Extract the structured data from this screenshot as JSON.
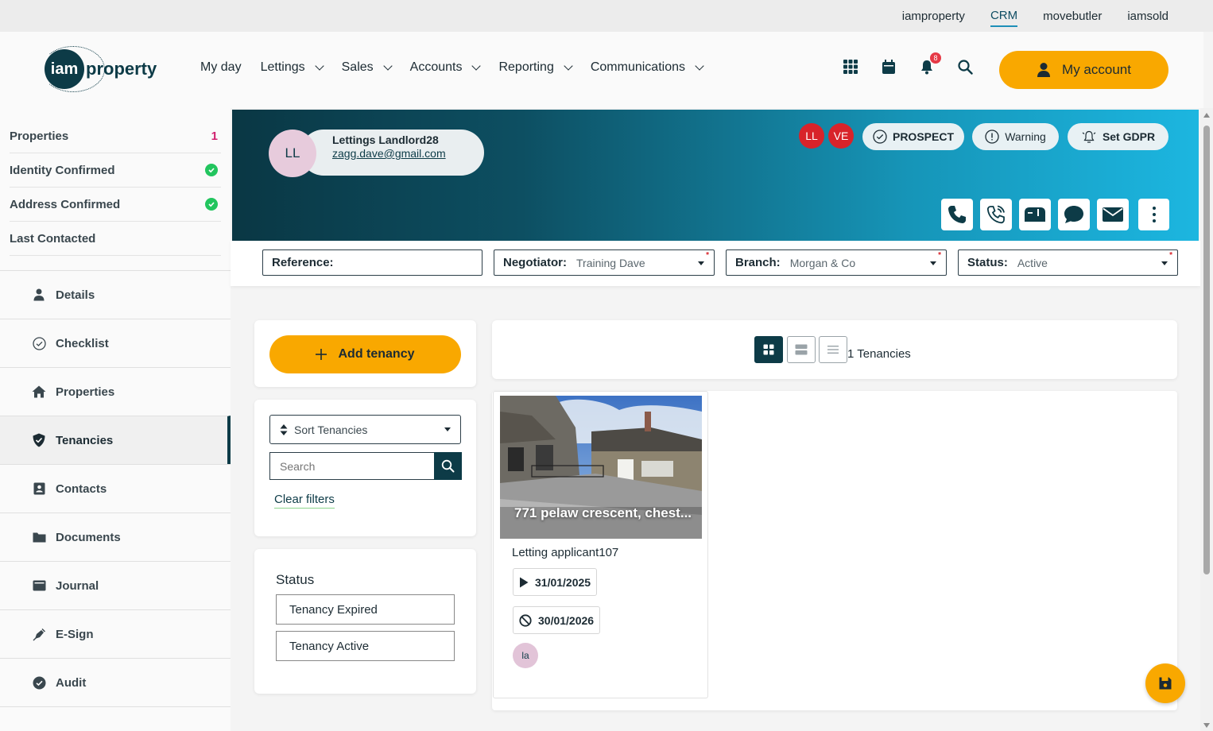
{
  "topbar": {
    "links": [
      "iamproperty",
      "CRM",
      "movebutler",
      "iamsold"
    ],
    "active": "CRM"
  },
  "header": {
    "logo_mark": "iam",
    "logo_word": "property",
    "nav": [
      {
        "label": "My day",
        "has_dropdown": false
      },
      {
        "label": "Lettings",
        "has_dropdown": true
      },
      {
        "label": "Sales",
        "has_dropdown": true
      },
      {
        "label": "Accounts",
        "has_dropdown": true
      },
      {
        "label": "Reporting",
        "has_dropdown": true
      },
      {
        "label": "Communications",
        "has_dropdown": true
      }
    ],
    "icons": [
      "apps-grid-icon",
      "calendar-icon",
      "bell-icon",
      "search-icon"
    ],
    "notification_count": "8",
    "account_label": "My account"
  },
  "sidebar": {
    "summary": [
      {
        "label": "Properties",
        "value": "1"
      },
      {
        "label": "Identity Confirmed",
        "status": "confirmed"
      },
      {
        "label": "Address Confirmed",
        "status": "confirmed"
      },
      {
        "label": "Last Contacted",
        "value": ""
      }
    ],
    "menu": [
      {
        "label": "Details",
        "icon": "person-icon"
      },
      {
        "label": "Checklist",
        "icon": "check-circle-icon"
      },
      {
        "label": "Properties",
        "icon": "home-icon"
      },
      {
        "label": "Tenancies",
        "icon": "shield-icon",
        "active": true
      },
      {
        "label": "Contacts",
        "icon": "contact-card-icon"
      },
      {
        "label": "Documents",
        "icon": "folder-icon"
      },
      {
        "label": "Journal",
        "icon": "journal-icon"
      },
      {
        "label": "E-Sign",
        "icon": "pen-icon"
      },
      {
        "label": "Audit",
        "icon": "check-badge-icon"
      }
    ]
  },
  "contact": {
    "initials": "LL",
    "name": "Lettings Landlord28",
    "email": "zagg.dave@gmail.com",
    "tag_avatars": [
      "LL",
      "VE"
    ],
    "pills": {
      "prospect": "PROSPECT",
      "warning": "Warning",
      "gdpr": "Set GDPR"
    },
    "actions": [
      "phone-icon",
      "phone-call-icon",
      "mailbox-icon",
      "chat-icon",
      "email-icon",
      "more-icon"
    ]
  },
  "filters": {
    "reference": {
      "label": "Reference:",
      "value": ""
    },
    "negotiator": {
      "label": "Negotiator:",
      "value": "Training Dave"
    },
    "branch": {
      "label": "Branch:",
      "value": "Morgan & Co"
    },
    "status": {
      "label": "Status:",
      "value": "Active"
    }
  },
  "tenancies": {
    "add_label": "Add tenancy",
    "sort_label": "Sort Tenancies",
    "search_placeholder": "Search",
    "clear_filters": "Clear filters",
    "status_title": "Status",
    "status_options": [
      "Tenancy Expired",
      "Tenancy Active"
    ],
    "count_label": "1 Tenancies",
    "view_modes": [
      "grid-view-icon",
      "card-view-icon",
      "list-view-icon"
    ],
    "active_view": "grid",
    "items": [
      {
        "address": "771 pelaw crescent, chest...",
        "applicant": "Letting applicant107",
        "start_date": "31/01/2025",
        "end_date": "30/01/2026",
        "avatar_initials": "la"
      }
    ]
  },
  "colors": {
    "brand_dark": "#0d3b47",
    "accent_orange": "#f9a800",
    "banner_light": "#1cb6e0",
    "tag_red": "#d8232a",
    "confirmed_green": "#22c55e"
  }
}
